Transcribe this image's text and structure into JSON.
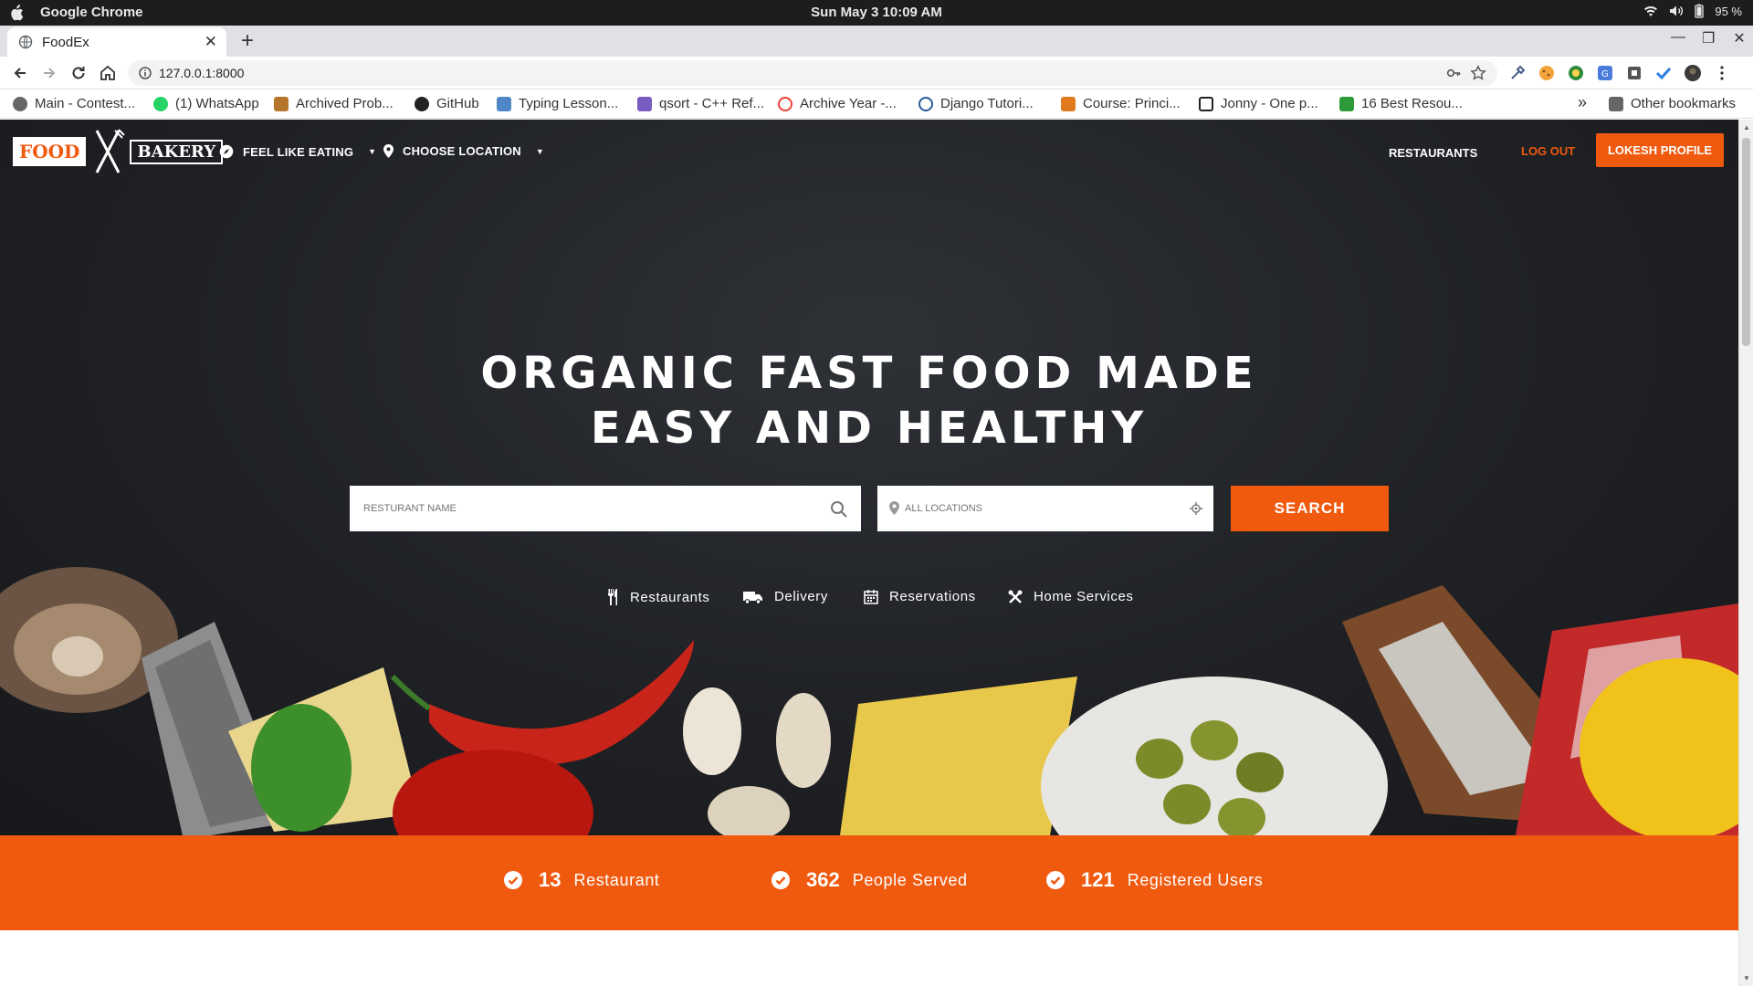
{
  "os": {
    "app_name": "Google Chrome",
    "clock": "Sun May 3  10:09 AM",
    "battery": "95 %"
  },
  "browser": {
    "tab_title": "FoodEx",
    "url": "127.0.0.1:8000",
    "bookmarks": [
      {
        "label": "Main - Contest..."
      },
      {
        "label": "(1) WhatsApp"
      },
      {
        "label": "Archived Prob..."
      },
      {
        "label": "GitHub"
      },
      {
        "label": "Typing Lesson..."
      },
      {
        "label": "qsort - C++ Ref..."
      },
      {
        "label": "Archive Year -..."
      },
      {
        "label": "Django Tutori..."
      },
      {
        "label": "Course: Princi..."
      },
      {
        "label": "Jonny - One p..."
      },
      {
        "label": "16 Best Resou..."
      }
    ],
    "more_bookmarks": "»",
    "other_bookmarks": "Other bookmarks"
  },
  "header": {
    "logo_left": "FOOD",
    "logo_right": "BAKERY",
    "feel_like_eating": "FEEL LIKE EATING",
    "choose_location": "CHOOSE LOCATION",
    "restaurants": "RESTAURANTS",
    "logout": "LOG OUT",
    "profile": "LOKESH PROFILE"
  },
  "hero": {
    "title_line1": "ORGANIC FAST FOOD MADE",
    "title_line2": "EASY AND HEALTHY",
    "search_name_placeholder": "RESTURANT NAME",
    "search_location_placeholder": "ALL LOCATIONS",
    "search_button": "SEARCH",
    "categories": [
      {
        "label": "Restaurants",
        "icon": "fork-knife-icon"
      },
      {
        "label": "Delivery",
        "icon": "truck-icon"
      },
      {
        "label": "Reservations",
        "icon": "calendar-icon"
      },
      {
        "label": "Home Services",
        "icon": "tools-icon"
      }
    ]
  },
  "stats": [
    {
      "number": "13",
      "label": "Restaurant"
    },
    {
      "number": "362",
      "label": "People Served"
    },
    {
      "number": "121",
      "label": "Registered Users"
    }
  ],
  "colors": {
    "accent": "#f05a0f",
    "hero_bg": "#1f2125"
  }
}
